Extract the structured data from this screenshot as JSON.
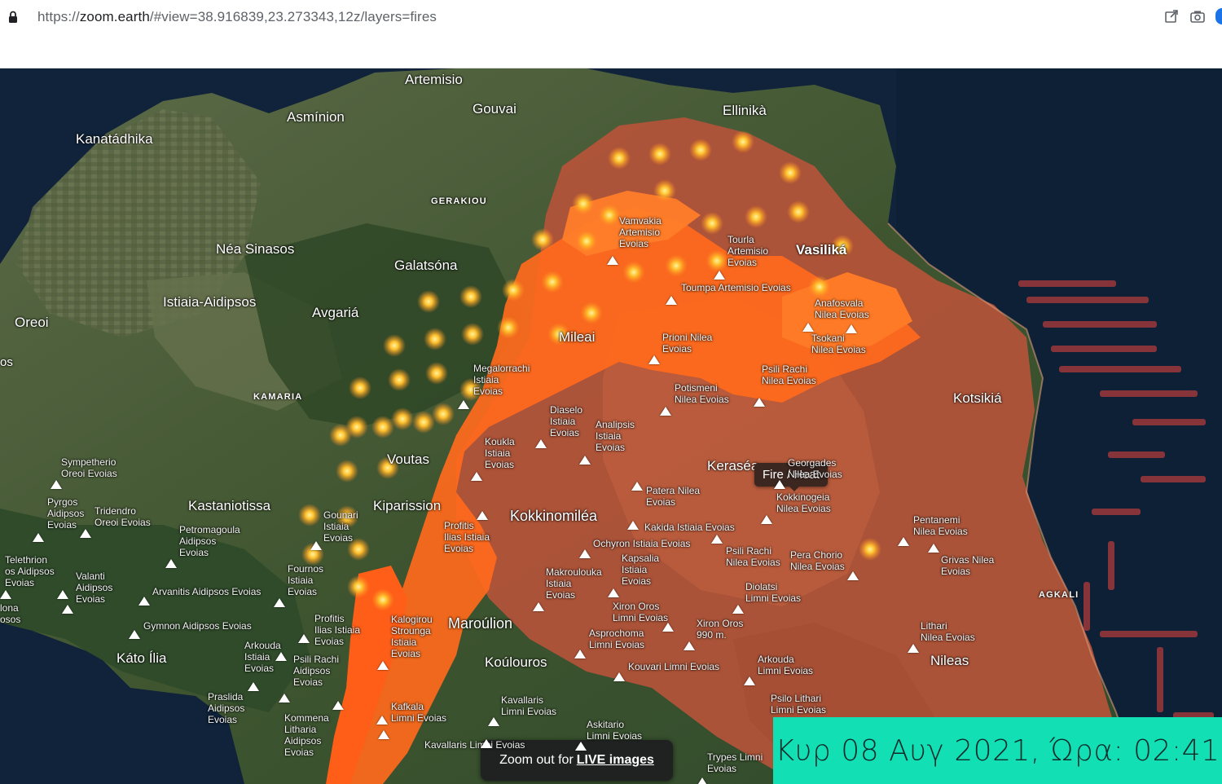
{
  "browser": {
    "url_prefix": "https://",
    "url_host": "zoom.earth",
    "url_path": "/#view=38.916839,23.273343,12z/layers=fires",
    "icons": [
      "lock-icon",
      "share-edit-icon",
      "camera-icon",
      "extension-icon"
    ]
  },
  "map": {
    "towns": {
      "artemisio": "Artemisio",
      "gouvai": "Gouvai",
      "ellinika": "Ellinikà",
      "asminion": "Asmínion",
      "kanatadhika": "Kanatádhika",
      "gerakiou": "GERAKIOU",
      "nea_sinasos": "Néa Sinasos",
      "galatsona": "Galatsóna",
      "istiaia_aidipsos": "Istiaia-Aidipsos",
      "avgaria": "Avgariá",
      "oreoi": "Oreoi",
      "os": "os",
      "mileai": "Mileai",
      "kamaria": "KAMARIA",
      "vasilika": "Vasiliká",
      "kotsikia": "Kotsikiá",
      "voutas": "Voutas",
      "kerasea": "Keraséa",
      "kastaniotissa": "Kastaniotissa",
      "kiparission": "Kiparission",
      "kokkinomilea": "Kokkinomiléa",
      "agkali": "AGKALI",
      "maroulion": "Maroúlion",
      "kato_ilia": "Káto Ília",
      "koulouros": "Koúlouros",
      "nileas": "Nileas"
    },
    "stations": {
      "vamvakia": [
        "Vamvakia",
        "Artemisio",
        "Evoias"
      ],
      "tourla": [
        "Tourla",
        "Artemisio",
        "Evoias"
      ],
      "toumpa": [
        "Toumpa Artemisio Evoias"
      ],
      "anafosvala": [
        "Anafosvala",
        "Nilea Evoias"
      ],
      "prioni": [
        "Prioni Nilea",
        "Evoias"
      ],
      "tsokani": [
        "Tsokani",
        "Nilea Evoias"
      ],
      "megalorrachi": [
        "Megalorrachi",
        "Istiaia",
        "Evoias"
      ],
      "psili_rachi_n": [
        "Psili Rachi",
        "Nilea Evoias"
      ],
      "potismeni": [
        "Potismeni",
        "Nilea Evoias"
      ],
      "diaselo": [
        "Diaselo",
        "Istiaia",
        "Evoias"
      ],
      "analipsis": [
        "Analipsis",
        "Istiaia",
        "Evoias"
      ],
      "koukla": [
        "Koukla",
        "Istiaia",
        "Evoias"
      ],
      "georgades": [
        "Georgades",
        "Nilea Evoias"
      ],
      "sympetherio": [
        "Sympetherio",
        "Oreoi Evoias"
      ],
      "patera": [
        "Patera Nilea",
        "Evoias"
      ],
      "kokkinogeia": [
        "Kokkinogeia",
        "Nilea Evoias"
      ],
      "pyrgos": [
        "Pyrgos",
        "Aidipsos",
        "Evoias"
      ],
      "tridendro": [
        "Tridendro",
        "Oreoi Evoias"
      ],
      "gounari": [
        "Gounari",
        "Istiaia",
        "Evoias"
      ],
      "profitis1": [
        "Profitis",
        "Ilias Istiaia",
        "Evoias"
      ],
      "kakida": [
        "Kakida Istiaia Evoias"
      ],
      "pentanemi": [
        "Pentanemi",
        "Nilea Evoias"
      ],
      "petromagoula": [
        "Petromagoula",
        "Aidipsos",
        "Evoias"
      ],
      "ochyron": [
        "Ochyron Istiaia Evoias"
      ],
      "psili_rachi2": [
        "Psili Rachi",
        "Nilea Evoias"
      ],
      "pera_chorio": [
        "Pera Chorio",
        "Nilea Evoias"
      ],
      "telethrion": [
        "Telethrion",
        "os Aidipsos",
        "Evoias"
      ],
      "valanti": [
        "Valanti",
        "Aidipsos",
        "Evoias"
      ],
      "kapsalia": [
        "Kapsalia",
        "Istiaia",
        "Evoias"
      ],
      "grivas": [
        "Grivas Nilea",
        "Evoias"
      ],
      "fournos": [
        "Fournos",
        "Istiaia",
        "Evoias"
      ],
      "makroulouka": [
        "Makroulouka",
        "Istiaia",
        "Evoias"
      ],
      "arvanitis": [
        "Arvanitis Aidipsos Evoias"
      ],
      "diolatsi": [
        "Diolatsi",
        "Limni Evoias"
      ],
      "lona": [
        "lona",
        "osos"
      ],
      "xiron_oros": [
        "Xiron Oros",
        "Limni Evoias"
      ],
      "profitis2": [
        "Profitis",
        "Ilias Istiaia",
        "Evoias"
      ],
      "kalogirou": [
        "Kalogirou",
        "Strounga",
        "Istiaia",
        "Evoias"
      ],
      "gymnon": [
        "Gymnon Aidipsos Evoias"
      ],
      "xiron_oros_peak": [
        "Xiron Oros",
        "990 m."
      ],
      "asprochoma": [
        "Asprochoma",
        "Limni Evoias"
      ],
      "lithari": [
        "Lithari",
        "Nilea Evoias"
      ],
      "arkouda1": [
        "Arkouda",
        "Istiaia",
        "Evoias"
      ],
      "psili_rachi3": [
        "Psili Rachi",
        "Aidipsos",
        "Evoias"
      ],
      "arkouda2": [
        "Arkouda",
        "Limni Evoias"
      ],
      "kouvari": [
        "Kouvari Limni Evoias"
      ],
      "praslida": [
        "Praslida",
        "Aidipsos",
        "Evoias"
      ],
      "kavallaris": [
        "Kavallaris",
        "Limni Evoias"
      ],
      "psilo_lithari": [
        "Psilo Lithari",
        "Limni Evoias"
      ],
      "kafkala": [
        "Kafkala",
        "Limni Evoias"
      ],
      "kommena": [
        "Kommena",
        "Litharia",
        "Aidipsos",
        "Evoias"
      ],
      "askitario": [
        "Askitario",
        "Limni Evoias"
      ],
      "kavallaris2": [
        "Kavallaris Limni Evoias"
      ],
      "trypes": [
        "Trypes Limni",
        "Evoias"
      ]
    },
    "tooltip": "Fire / Heat",
    "zoom_out_prefix": "Zoom out for",
    "zoom_out_link": "LIVE images"
  },
  "overlay": {
    "date_time": "Κυρ 08 Αυγ 2021, Ώρα: 02:41",
    "color": "#12dfb4"
  },
  "colors": {
    "sea": "#10233a",
    "land": "#4a5a3a",
    "burn": "#d2552e",
    "active_fire": "#ff7a1a",
    "hotspot": "#ffcc33"
  }
}
